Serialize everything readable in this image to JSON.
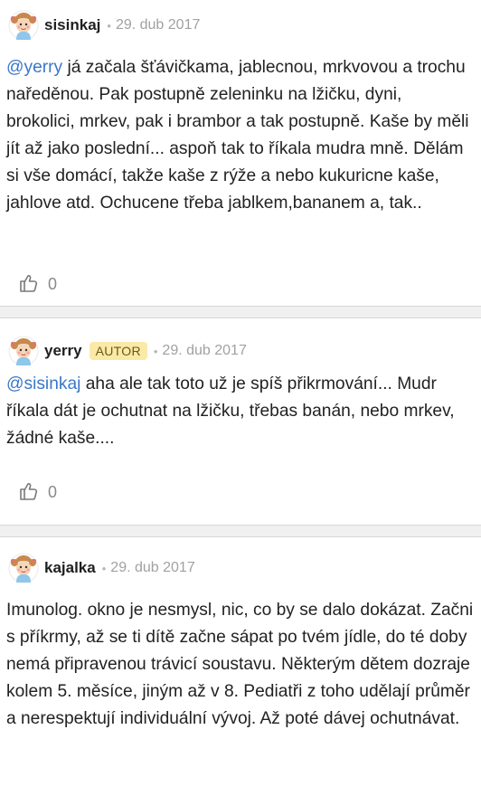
{
  "comments": [
    {
      "username": "sisinkaj",
      "date": "29. dub 2017",
      "mention": "@yerry",
      "text": " já začala šťávičkama, jablecnou, mrkvovou a trochu naředěnou. Pak postupně zeleninku na lžičku, dyni, brokolici, mrkev, pak i brambor a tak postupně. Kaše by měli jít až jako poslední... aspoň tak to říkala mudra mně. Dělám si vše domácí, takže kaše z rýže a nebo kukuricne kaše, jahlove atd. Ochucene třeba jablkem,bananem a, tak..",
      "likes": "0"
    },
    {
      "username": "yerry",
      "badge": "AUTOR",
      "date": "29. dub 2017",
      "mention": "@sisinkaj",
      "text": " aha ale tak toto už je spíš přikrmování... Mudr říkala dát je ochutnat na lžičku, třebas banán, nebo mrkev, žádné kaše....",
      "likes": "0"
    },
    {
      "username": "kajalka",
      "date": "29. dub 2017",
      "text": "Imunolog. okno je nesmysl, nic, co by se dalo dokázat. Začni s příkrmy, až se ti dítě začne sápat po tvém jídle, do té doby nemá připravenou trávicí soustavu. Některým dětem dozraje kolem 5. měsíce, jiným až v 8. Pediatři z toho udělají průměr a nerespektují individuální vývoj. Až poté dávej ochutnávat."
    }
  ],
  "separator": "•",
  "icons": {
    "avatar": "smiling-girl-avatar-icon",
    "like": "thumbs-up-icon"
  }
}
